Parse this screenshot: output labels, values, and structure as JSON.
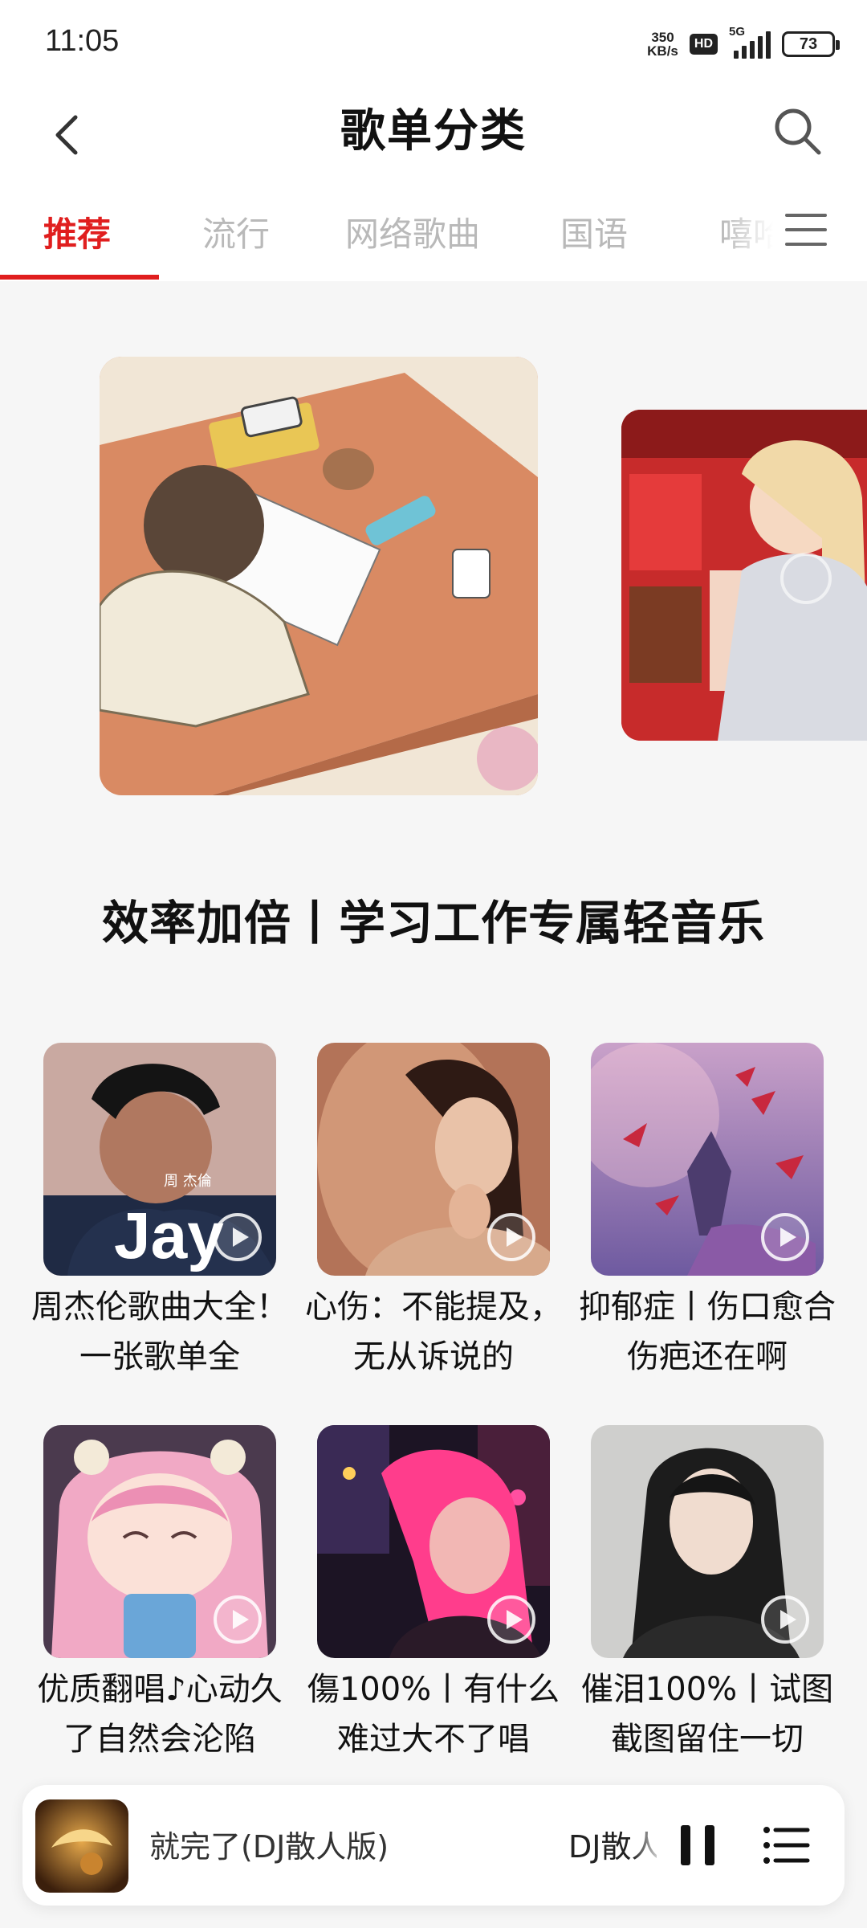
{
  "status_bar": {
    "time": "11:05",
    "net_speed_value": "350",
    "net_speed_unit": "KB/s",
    "hd_badge": "HD",
    "network": "5G",
    "battery": "73"
  },
  "header": {
    "title": "歌单分类",
    "back_icon": "chevron-left-icon",
    "search_icon": "search-icon"
  },
  "tabs": [
    {
      "label": "推荐",
      "active": true
    },
    {
      "label": "流行",
      "active": false
    },
    {
      "label": "网络歌曲",
      "active": false
    },
    {
      "label": "国语",
      "active": false
    },
    {
      "label": "嘻哈",
      "active": false
    }
  ],
  "tabs_menu_icon": "menu-icon",
  "banner": {
    "title": "效率加倍丨学习工作专属轻音乐"
  },
  "playlists": [
    {
      "title": "周杰伦歌曲大全！一张歌单全",
      "cover_text_small": "周 杰倫",
      "cover_text_big": "Jay"
    },
    {
      "title": "心伤：不能提及，无从诉说的"
    },
    {
      "title": "抑郁症丨伤口愈合伤疤还在啊"
    },
    {
      "title": "优质翻唱♪心动久了自然会沦陷"
    },
    {
      "title": "傷100%丨有什么难过大不了唱"
    },
    {
      "title": "催泪100%丨试图截图留住一切"
    }
  ],
  "mini_player": {
    "song": "就完了(DJ散人版)",
    "artist": "DJ散人",
    "pause_icon": "pause-icon",
    "playlist_icon": "playlist-icon"
  },
  "colors": {
    "accent": "#e01e1e",
    "tab_inactive": "#b9b9b9",
    "background": "#f6f6f6"
  }
}
